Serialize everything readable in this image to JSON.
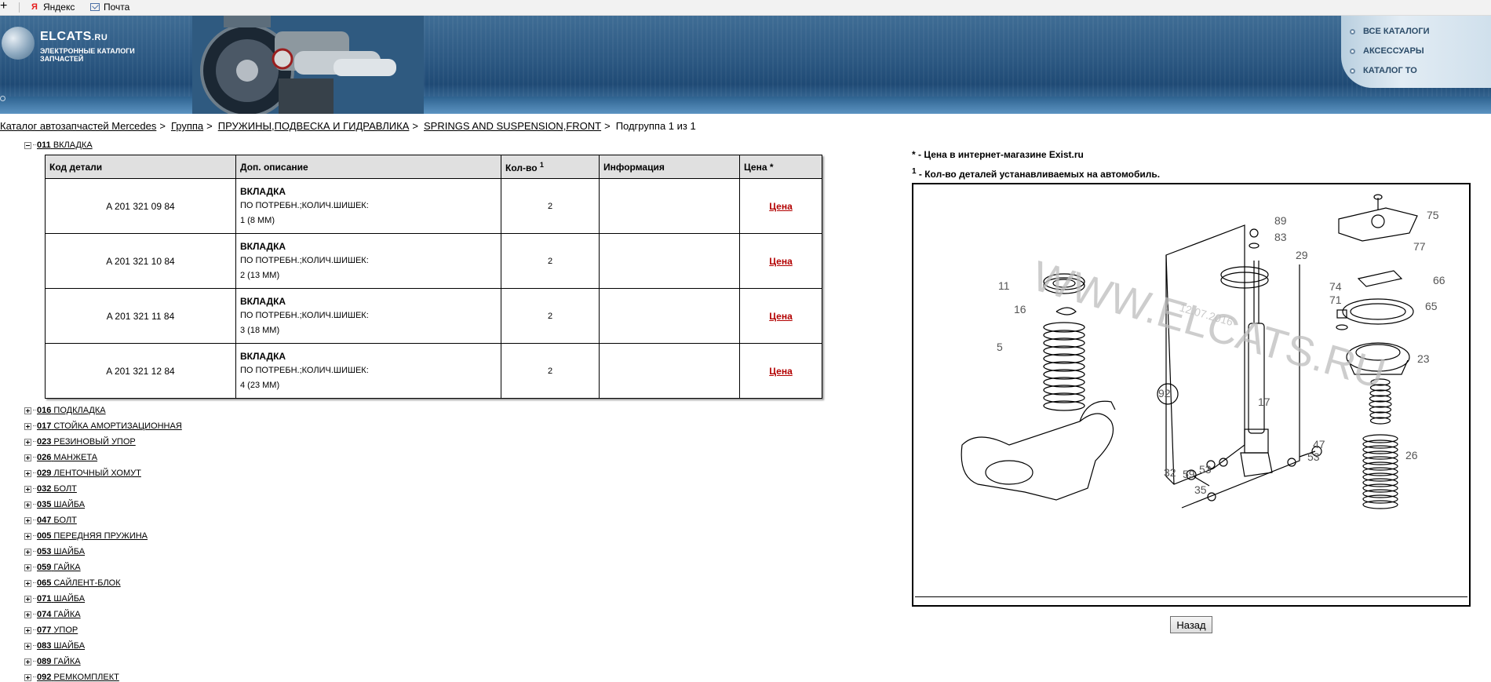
{
  "bookmarks": [
    {
      "label": "Яндекс",
      "icon": "yandex-icon"
    },
    {
      "label": "Почта",
      "icon": "mail-icon"
    }
  ],
  "header": {
    "logo_title": "ELCATS",
    "logo_domain": ".RU",
    "logo_subtitle": "ЭЛЕКТРОННЫЕ КАТАЛОГИ ЗАПЧАСТЕЙ",
    "menu": [
      "ВСЕ КАТАЛОГИ",
      "АКСЕССУАРЫ",
      "КАТАЛОГ ТО"
    ]
  },
  "breadcrumb": {
    "items": [
      "Каталог автозапчастей Mercedes",
      "Группа",
      "ПРУЖИНЫ,ПОДВЕСКА И ГИДРАВЛИКА",
      "SPRINGS AND SUSPENSION,FRONT"
    ],
    "current": "Подгруппа 1 из 1",
    "separator": ">"
  },
  "tree": {
    "open": {
      "code": "011",
      "name": "ВКЛАДКА"
    },
    "items": [
      {
        "code": "016",
        "name": "ПОДКЛАДКА"
      },
      {
        "code": "017",
        "name": "СТОЙКА АМОРТИЗАЦИОННАЯ"
      },
      {
        "code": "023",
        "name": "РЕЗИНОВЫЙ УПОР"
      },
      {
        "code": "026",
        "name": "МАНЖЕТА"
      },
      {
        "code": "029",
        "name": "ЛЕНТОЧНЫЙ ХОМУТ"
      },
      {
        "code": "032",
        "name": "БОЛТ"
      },
      {
        "code": "035",
        "name": "ШАЙБА"
      },
      {
        "code": "047",
        "name": "БОЛТ"
      },
      {
        "code": "005",
        "name": "ПЕРЕДНЯЯ ПРУЖИНА"
      },
      {
        "code": "053",
        "name": "ШАЙБА"
      },
      {
        "code": "059",
        "name": "ГАЙКА"
      },
      {
        "code": "065",
        "name": "САЙЛЕНТ-БЛОК"
      },
      {
        "code": "071",
        "name": "ШАЙБА"
      },
      {
        "code": "074",
        "name": "ГАЙКА"
      },
      {
        "code": "077",
        "name": "УПОР"
      },
      {
        "code": "083",
        "name": "ШАЙБА"
      },
      {
        "code": "089",
        "name": "ГАЙКА"
      },
      {
        "code": "092",
        "name": "РЕМКОМПЛЕКТ"
      }
    ]
  },
  "table": {
    "headers": {
      "code": "Код детали",
      "desc": "Доп. описание",
      "qty": "Кол-во",
      "qty_sup": "1",
      "info": "Информация",
      "price": "Цена *"
    },
    "rows": [
      {
        "code": "A  201 321 09 84",
        "name": "ВКЛАДКА",
        "line1": "ПО ПОТРЕБН.;КОЛИЧ.ШИШЕК:",
        "line2": "1 (8 ММ)",
        "qty": "2",
        "info": "",
        "price": "Цена"
      },
      {
        "code": "A  201 321 10 84",
        "name": "ВКЛАДКА",
        "line1": "ПО ПОТРЕБН.;КОЛИЧ.ШИШЕК:",
        "line2": "2 (13 ММ)",
        "qty": "2",
        "info": "",
        "price": "Цена"
      },
      {
        "code": "A  201 321 11 84",
        "name": "ВКЛАДКА",
        "line1": "ПО ПОТРЕБН.;КОЛИЧ.ШИШЕК:",
        "line2": "3 (18 ММ)",
        "qty": "2",
        "info": "",
        "price": "Цена"
      },
      {
        "code": "A  201 321 12 84",
        "name": "ВКЛАДКА",
        "line1": "ПО ПОТРЕБН.;КОЛИЧ.ШИШЕК:",
        "line2": "4 (23 ММ)",
        "qty": "2",
        "info": "",
        "price": "Цена"
      }
    ]
  },
  "notes": {
    "price_note": "* - Цена в интернет-магазине Exist.ru",
    "qty_note_sup": "1",
    "qty_note": " - Кол-во деталей устанавливаемых на автомобиль."
  },
  "diagram": {
    "watermark": "WWW.ELCATS.RU",
    "date": "12.07.2016",
    "callouts": [
      "89",
      "83",
      "29",
      "75",
      "77",
      "11",
      "16",
      "66",
      "74",
      "71",
      "65",
      "5",
      "92",
      "17",
      "23",
      "53",
      "47",
      "32",
      "59",
      "53",
      "35",
      "26"
    ]
  },
  "buttons": {
    "back": "Назад"
  }
}
